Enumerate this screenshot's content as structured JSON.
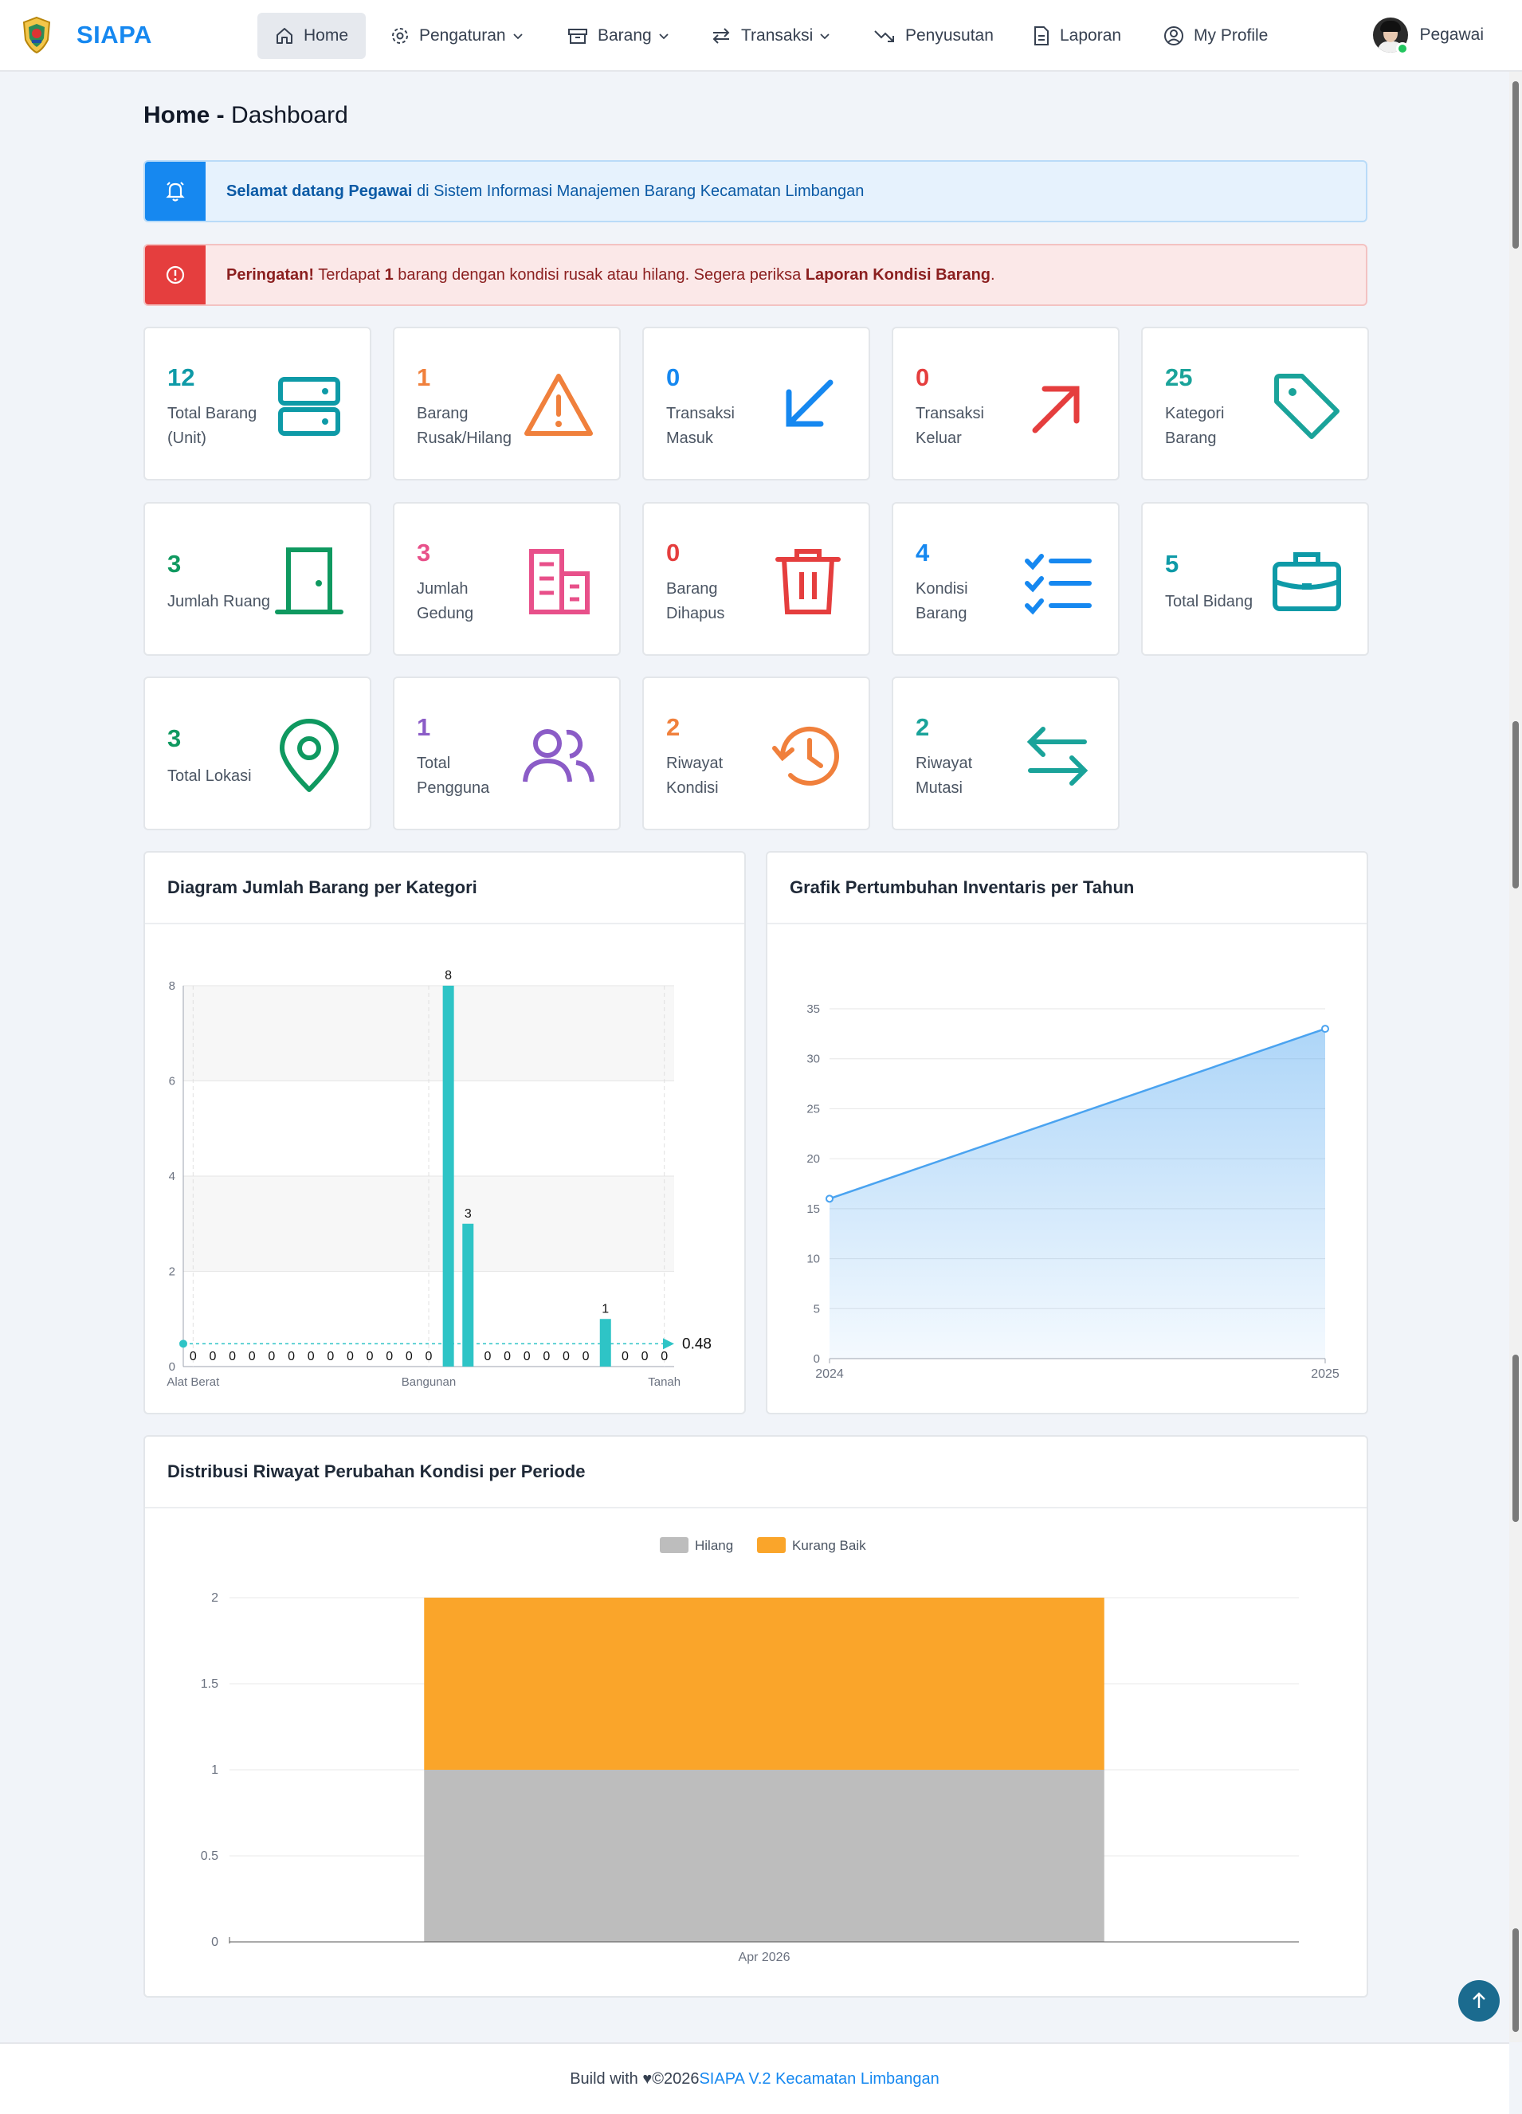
{
  "app": {
    "name": "SIAPA"
  },
  "nav": {
    "home": "Home",
    "pengaturan": "Pengaturan",
    "barang": "Barang",
    "transaksi": "Transaksi",
    "penyusutan": "Penyusutan",
    "laporan": "Laporan",
    "profile": "My Profile",
    "user": "Pegawai"
  },
  "page": {
    "title_bold": "Home -",
    "title_rest": " Dashboard"
  },
  "alerts": {
    "welcome_bold": "Selamat datang Pegawai",
    "welcome_rest": " di Sistem Informasi Manajemen Barang Kecamatan Limbangan",
    "warn_bold": "Peringatan!",
    "warn_a": " Terdapat ",
    "warn_count": "1",
    "warn_b": " barang dengan kondisi rusak atau hilang. Segera periksa ",
    "warn_link": "Laporan Kondisi Barang",
    "warn_end": "."
  },
  "stats": [
    {
      "value": "12",
      "label": "Total Barang (Unit)",
      "icon": "server-icon",
      "color": "#0e9aa7"
    },
    {
      "value": "1",
      "label": "Barang Rusak/Hilang",
      "icon": "warning-icon",
      "color": "#f0803c"
    },
    {
      "value": "0",
      "label": "Transaksi Masuk",
      "icon": "arrow-down-left-icon",
      "color": "#1688f0"
    },
    {
      "value": "0",
      "label": "Transaksi Keluar",
      "icon": "arrow-up-right-icon",
      "color": "#e53e3e"
    },
    {
      "value": "25",
      "label": "Kategori Barang",
      "icon": "tag-icon",
      "color": "#1aa39a"
    },
    {
      "value": "3",
      "label": "Jumlah Ruang",
      "icon": "door-icon",
      "color": "#0f9960"
    },
    {
      "value": "3",
      "label": "Jumlah Gedung",
      "icon": "building-icon",
      "color": "#e8508a"
    },
    {
      "value": "0",
      "label": "Barang Dihapus",
      "icon": "trash-icon",
      "color": "#e53e3e"
    },
    {
      "value": "4",
      "label": "Kondisi Barang",
      "icon": "checklist-icon",
      "color": "#1688f0"
    },
    {
      "value": "5",
      "label": "Total Bidang",
      "icon": "briefcase-icon",
      "color": "#0e9aa7"
    },
    {
      "value": "3",
      "label": "Total Lokasi",
      "icon": "map-pin-icon",
      "color": "#0f9960"
    },
    {
      "value": "1",
      "label": "Total Pengguna",
      "icon": "users-icon",
      "color": "#8b5cc7"
    },
    {
      "value": "2",
      "label": "Riwayat Kondisi",
      "icon": "history-icon",
      "color": "#f0803c"
    },
    {
      "value": "2",
      "label": "Riwayat Mutasi",
      "icon": "swap-icon",
      "color": "#1aa39a"
    }
  ],
  "panels": {
    "kategori_title": "Diagram Jumlah Barang per Kategori",
    "growth_title": "Grafik Pertumbuhan Inventaris per Tahun",
    "kondisi_title": "Distribusi Riwayat Perubahan Kondisi per Periode"
  },
  "chart_data": [
    {
      "type": "bar",
      "title": "Diagram Jumlah Barang per Kategori",
      "values": [
        0,
        0,
        0,
        0,
        0,
        0,
        0,
        0,
        0,
        0,
        0,
        0,
        0,
        8,
        3,
        0,
        0,
        0,
        0,
        0,
        0,
        1,
        0,
        0,
        0
      ],
      "visible_x_ticks": [
        "Alat Berat",
        "Bangunan",
        "Tanah"
      ],
      "ylim": [
        0,
        8
      ],
      "yticks": [
        0,
        2,
        4,
        6,
        8
      ],
      "reference_line": {
        "value": 0.48,
        "label": "0.48"
      },
      "color": "#2ec4c6"
    },
    {
      "type": "area",
      "title": "Grafik Pertumbuhan Inventaris per Tahun",
      "x": [
        "2024",
        "2025"
      ],
      "values": [
        16,
        33
      ],
      "ylim": [
        0,
        35
      ],
      "yticks": [
        0,
        5,
        10,
        15,
        20,
        25,
        30,
        35
      ],
      "color": "#4aa3f0"
    },
    {
      "type": "bar",
      "stacked": true,
      "title": "Distribusi Riwayat Perubahan Kondisi per Periode",
      "categories": [
        "Apr 2026"
      ],
      "series": [
        {
          "name": "Hilang",
          "values": [
            1
          ],
          "color": "#bdbdbd"
        },
        {
          "name": "Kurang Baik",
          "values": [
            1
          ],
          "color": "#faa52a"
        }
      ],
      "ylim": [
        0,
        2
      ],
      "yticks": [
        "0",
        "0.5",
        "1",
        "1.5",
        "2"
      ],
      "legend": "top-center"
    }
  ],
  "footer": {
    "prefix": "Build with",
    "heart": "♥",
    "year": " ©2026 ",
    "link": "SIAPA V.2 Kecamatan Limbangan"
  }
}
